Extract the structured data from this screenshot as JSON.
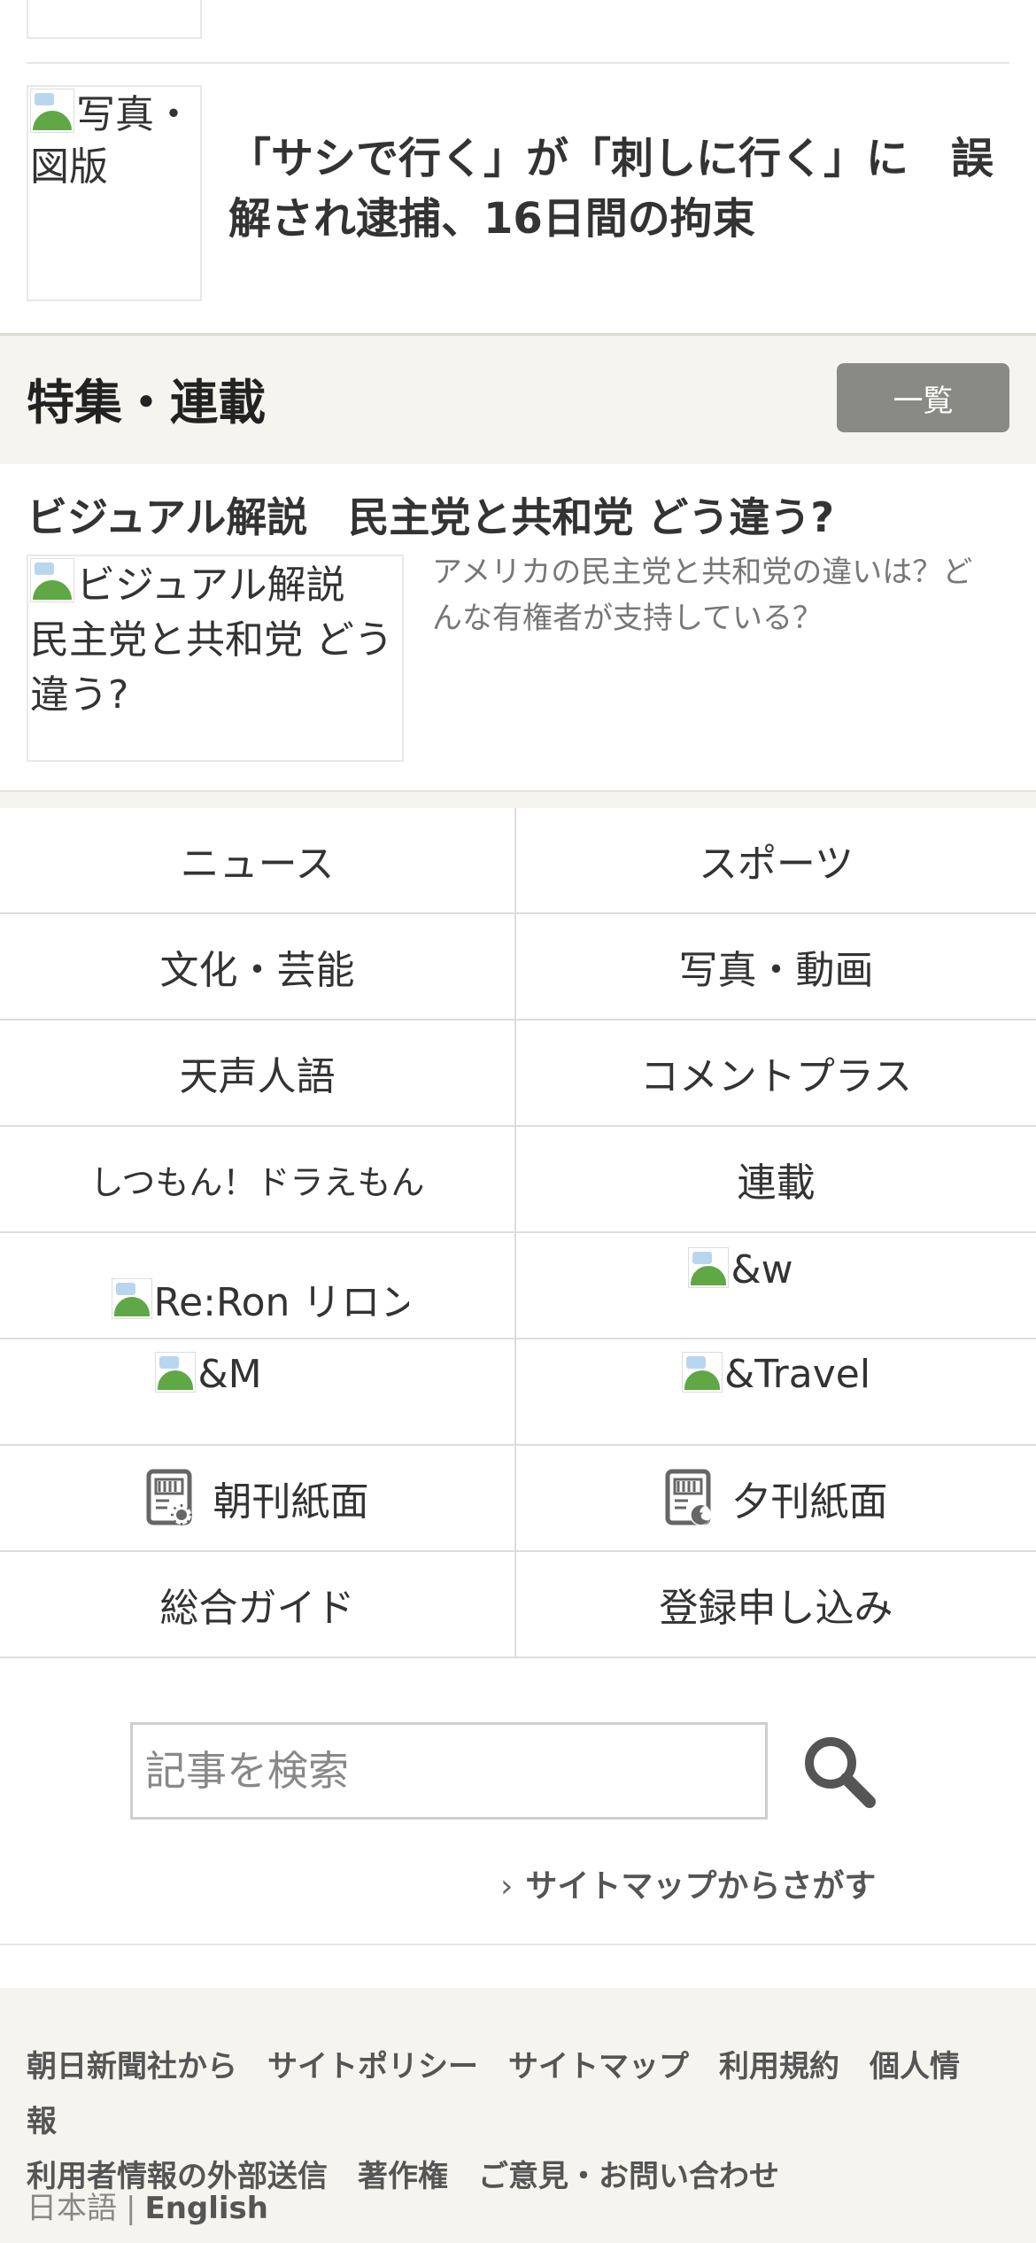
{
  "top_article": {
    "thumb_alt": "写真・図版",
    "title": "「サシで行く」が「刺しに行く」に　誤解され逮捕、16日間の拘束"
  },
  "feature": {
    "section_title": "特集・連載",
    "list_button": "一覧",
    "heading": "ビジュアル解説　民主党と共和党 どう違う?",
    "thumb_alt": "ビジュアル解説　民主党と共和党 どう違う?",
    "description": "アメリカの民主党と共和党の違いは？どんな有権者が支持している？"
  },
  "nav": {
    "news": "ニュース",
    "sports": "スポーツ",
    "culture": "文化・芸能",
    "photo_video": "写真・動画",
    "tensei_jingo": "天声人語",
    "comment_plus": "コメントプラス",
    "shitsumon_doraemon": "しつもん！ドラえもん",
    "rensai": "連載",
    "reron": "Re:Ron リロン",
    "and_w": "&w",
    "and_m": "&M",
    "and_travel": "&Travel",
    "morning_paper": "朝刊紙面",
    "evening_paper": "夕刊紙面",
    "guide": "総合ガイド",
    "register": "登録申し込み"
  },
  "search": {
    "placeholder": "記事を検索",
    "sitemap_link": "サイトマップからさがす"
  },
  "footer": {
    "links": [
      "朝日新聞社から",
      "サイトポリシー",
      "サイトマップ",
      "利用規約",
      "個人情報",
      "利用者情報の外部送信",
      "著作権",
      "ご意見・お問い合わせ"
    ],
    "lang_ja": "日本語",
    "lang_sep": "|",
    "lang_en": "English"
  },
  "colors": {
    "feature_band": "#f5f4ef",
    "list_button_bg": "#8a8a85",
    "text": "#333333"
  }
}
